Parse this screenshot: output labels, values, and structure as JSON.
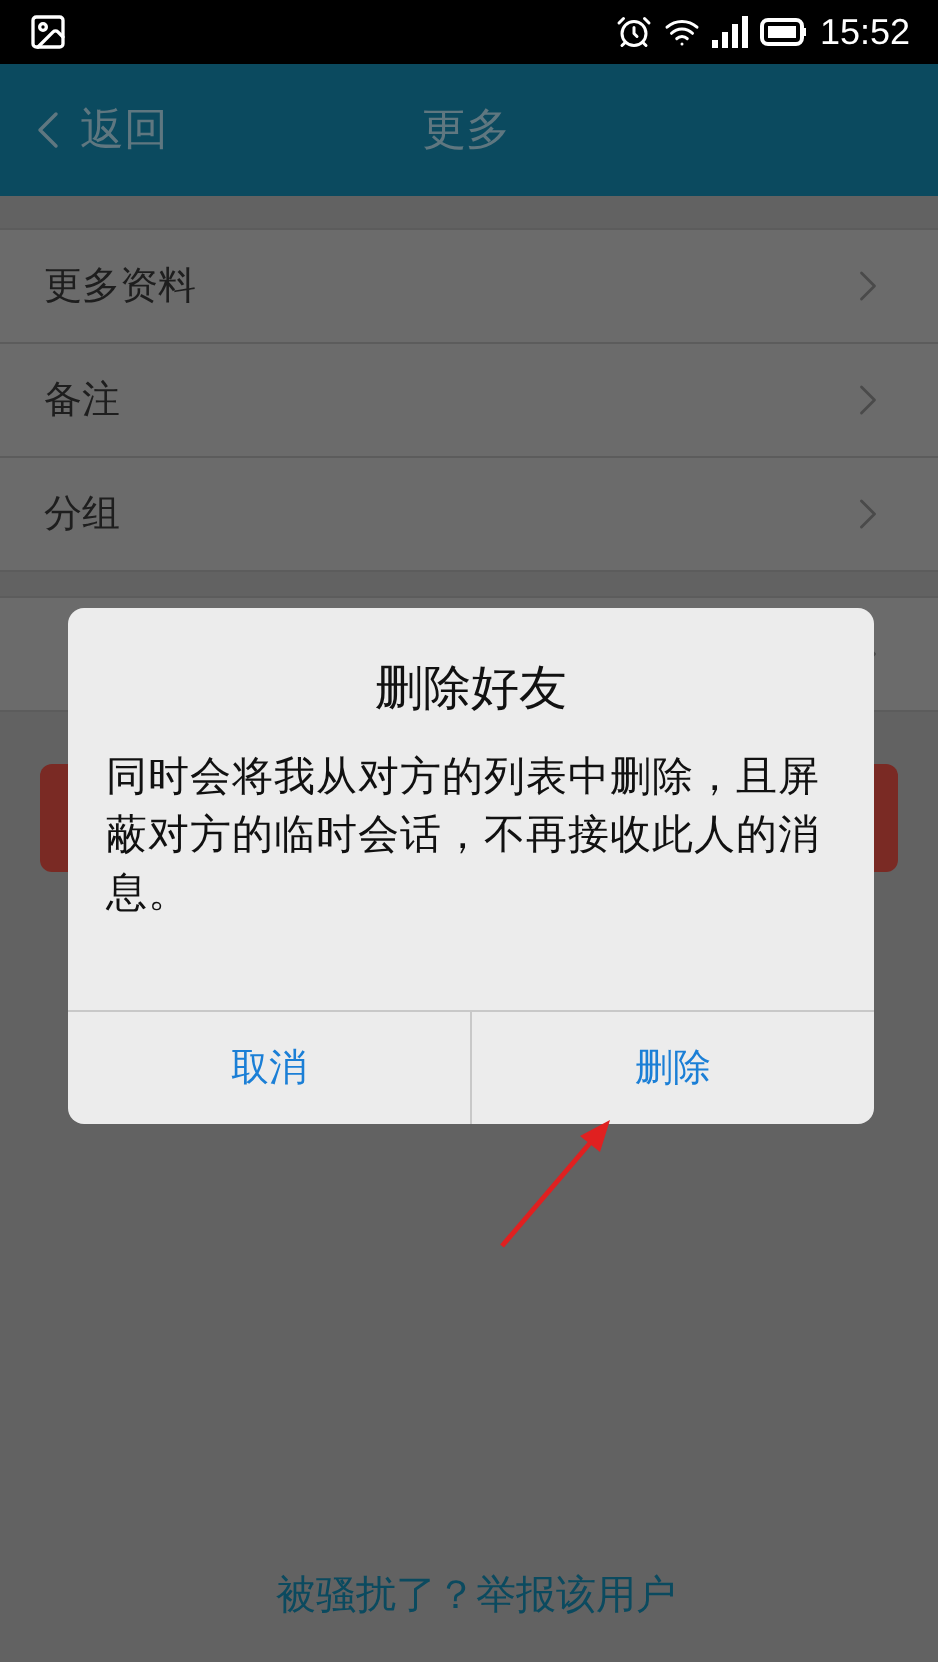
{
  "status_bar": {
    "time": "15:52"
  },
  "nav": {
    "back": "返回",
    "title": "更多"
  },
  "list": [
    {
      "label": "更多资料"
    },
    {
      "label": "备注"
    },
    {
      "label": "分组"
    }
  ],
  "dialog": {
    "title": "删除好友",
    "message": "同时会将我从对方的列表中删除，且屏蔽对方的临时会话，不再接收此人的消息。",
    "buttons": [
      "取消",
      "删除"
    ]
  },
  "report_link": "被骚扰了？举报该用户"
}
